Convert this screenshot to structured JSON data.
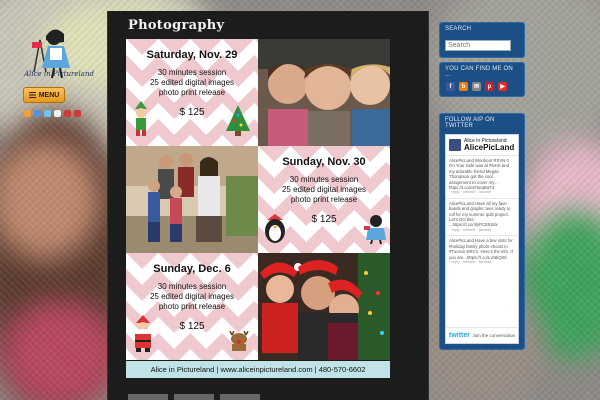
{
  "site": {
    "logo_text": "Alice in Pictureland",
    "menu_label": "MENU"
  },
  "main": {
    "title": "Photography",
    "sessions": [
      {
        "date": "Saturday, Nov. 29",
        "line1": "30 minutes session",
        "line2": "25 edited digital images",
        "line3": "photo print release",
        "price": "$ 125"
      },
      {
        "date": "Sunday, Nov. 30",
        "line1": "30 minutes session",
        "line2": "25 edited digital images",
        "line3": "photo print release",
        "price": "$ 125"
      },
      {
        "date": "Sunday, Dec. 6",
        "line1": "30 minutes session",
        "line2": "25 edited digital images",
        "line3": "photo print release",
        "price": "$ 125"
      }
    ],
    "footer": "Alice in Pictureland | www.aliceinpictureland.com | 480-570-6602"
  },
  "sidebar": {
    "search_title": "SEARCH",
    "search_placeholder": "Search",
    "find_title": "YOU CAN FIND ME ON ...",
    "find_icons": [
      "f",
      "b",
      "✉",
      "p",
      "▶"
    ],
    "twitter_title": "FOLLOW AIP ON TWITTER",
    "twitter_name": "Alice in Pictureland",
    "twitter_handle": "AlicePicLand",
    "tweets": [
      "AlicePicLand Woohoo! RSVN 0 On Your Side was at #NHS and my adorable friend Megan Thompson got the cool assignment to cover my... https://t.co/xsFkeqBaT4",
      "AlicePicLand Have all my fave bands and graphic tees ready to roll for my summer quilt project. Let's DO this: ...https://t.co/4lyPCE5Sdx",
      "AlicePicLand Have a few slots for #holiday family photo shoots in #Tucson ERCV. Here's the info. If you are...https://t.co/Lvh8iQXtl"
    ],
    "tweet_actions": "· reply · retweet · favorite",
    "twitter_logo": "twitter",
    "twitter_join": "Join the conversation"
  }
}
